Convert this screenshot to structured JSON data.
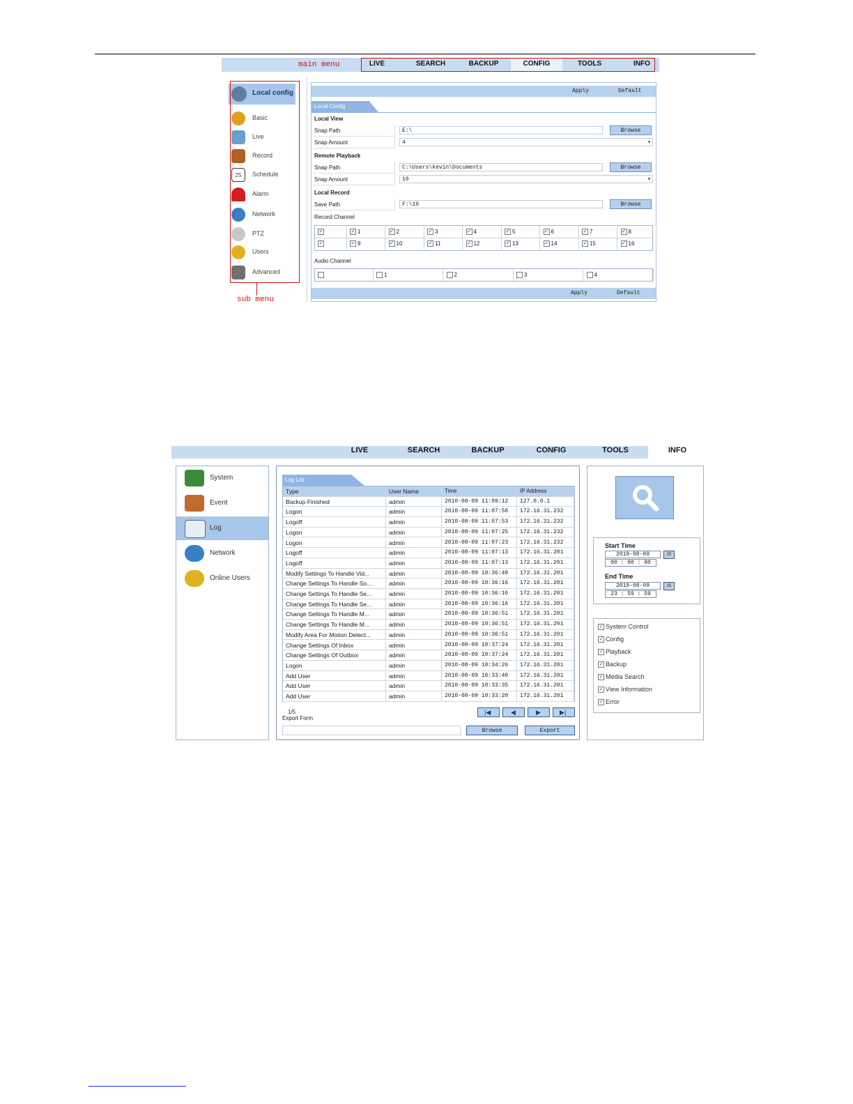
{
  "screenshot1": {
    "main_menu_annotation": "main menu",
    "sub_menu_annotation": "sub menu",
    "tabs": [
      "LIVE",
      "SEARCH",
      "BACKUP",
      "CONFIG",
      "TOOLS",
      "INFO"
    ],
    "active_tab": "CONFIG",
    "sidebar_header": "Local config",
    "sidebar_items": [
      "Basic",
      "Live",
      "Record",
      "Schedule",
      "Alarm",
      "Network",
      "PTZ",
      "Users",
      "Advanced"
    ],
    "schedule_icon_text": "25",
    "apply_label": "Apply",
    "default_label": "Default",
    "panel_tab": "Local Config",
    "local_view": {
      "title": "Local View",
      "snap_path_label": "Snap Path",
      "snap_path_value": "E:\\",
      "snap_amount_label": "Snap Amount",
      "snap_amount_value": "4"
    },
    "remote_playback": {
      "title": "Remote Playback",
      "snap_path_label": "Snap Path",
      "snap_path_value": "C:\\Users\\kevin\\Documents",
      "snap_amount_label": "Snap Amount",
      "snap_amount_value": "10"
    },
    "local_record": {
      "title": "Local Record",
      "save_path_label": "Save Path",
      "save_path_value": "F:\\10"
    },
    "browse_label": "Browse",
    "record_channel_label": "Record Channel",
    "record_channels_row1": [
      "1",
      "2",
      "3",
      "4",
      "5",
      "6",
      "7",
      "8"
    ],
    "record_channels_row2": [
      "9",
      "10",
      "11",
      "12",
      "13",
      "14",
      "15",
      "16"
    ],
    "audio_channel_label": "Audio Channel",
    "audio_channels": [
      "1",
      "2",
      "3",
      "4"
    ]
  },
  "screenshot2": {
    "tabs": [
      "LIVE",
      "SEARCH",
      "BACKUP",
      "CONFIG",
      "TOOLS",
      "INFO"
    ],
    "active_tab": "INFO",
    "left_items": [
      "System",
      "Event",
      "Log",
      "Network",
      "Online Users"
    ],
    "selected_left_item": "Log",
    "log_tab": "Log List",
    "columns": [
      "Type",
      "User Name",
      "Time",
      "IP Address"
    ],
    "rows": [
      [
        "Backup Finished",
        "admin",
        "2010-08-09 11:09:12",
        "127.0.0.1"
      ],
      [
        "Logon",
        "admin",
        "2010-08-09 11:07:58",
        "172.16.31.232"
      ],
      [
        "Logoff",
        "admin",
        "2010-08-09 11:07:53",
        "172.16.31.232"
      ],
      [
        "Logon",
        "admin",
        "2010-08-09 11:07:25",
        "172.16.31.232"
      ],
      [
        "Logon",
        "admin",
        "2010-08-09 11:07:23",
        "172.16.31.232"
      ],
      [
        "Logoff",
        "admin",
        "2010-08-09 11:07:13",
        "172.16.31.201"
      ],
      [
        "Logoff",
        "admin",
        "2010-08-09 11:07:13",
        "172.16.31.201"
      ],
      [
        "Modify Settings To Handle Vid...",
        "admin",
        "2010-08-09 10:36:48",
        "172.16.31.201"
      ],
      [
        "Change Settings To Handle So...",
        "admin",
        "2010-08-09 10:36:16",
        "172.16.31.201"
      ],
      [
        "Change Settings To Handle Se...",
        "admin",
        "2010-08-09 10:36:16",
        "172.16.31.201"
      ],
      [
        "Change Settings To Handle Se...",
        "admin",
        "2010-08-09 10:36:16",
        "172.16.31.201"
      ],
      [
        "Change Settings To Handle M...",
        "admin",
        "2010-08-09 10:36:51",
        "172.16.31.201"
      ],
      [
        "Change Settings To Handle M...",
        "admin",
        "2010-08-09 10:36:51",
        "172.16.31.201"
      ],
      [
        "Modify Area For Motion Detect...",
        "admin",
        "2010-08-09 10:36:51",
        "172.16.31.201"
      ],
      [
        "Change Settings Of Inbox",
        "admin",
        "2010-08-09 10:37:24",
        "172.16.31.201"
      ],
      [
        "Change Settings Of Outbox",
        "admin",
        "2010-08-09 10:37:24",
        "172.16.31.201"
      ],
      [
        "Logon",
        "admin",
        "2010-08-09 10:34:26",
        "172.16.31.201"
      ],
      [
        "Add User",
        "admin",
        "2010-08-09 10:33:40",
        "172.16.31.201"
      ],
      [
        "Add User",
        "admin",
        "2010-08-09 10:33:35",
        "172.16.31.201"
      ],
      [
        "Add User",
        "admin",
        "2010-08-09 10:33:20",
        "172.16.31.201"
      ]
    ],
    "page_indicator": "1/5",
    "export_form_label": "Export Form",
    "browse_label": "Browse",
    "export_label": "Export",
    "start_time_label": "Start Time",
    "start_date": "2010-08-09",
    "start_clock": "00 : 00 : 00",
    "end_time_label": "End Time",
    "end_date": "2010-08-09",
    "end_clock": "23 : 59 : 59",
    "calendar_icon_text": "25",
    "filters": [
      "System Control",
      "Config",
      "Playback",
      "Backup",
      "Media Search",
      "View Information",
      "Error"
    ]
  }
}
